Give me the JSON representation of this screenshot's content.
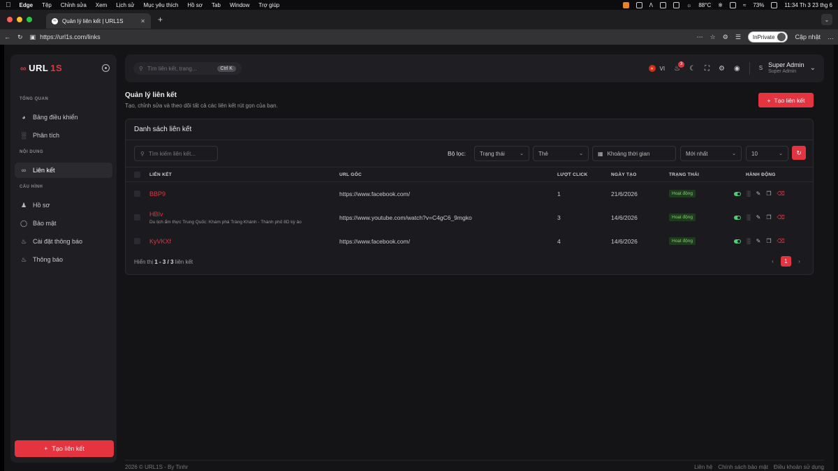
{
  "macbar": {
    "apple": "",
    "menus": [
      "Edge",
      "Tệp",
      "Chỉnh sửa",
      "Xem",
      "Lịch sử",
      "Mục yêu thích",
      "Hồ sơ",
      "Tab",
      "Window",
      "Trợ giúp"
    ],
    "weather": "88°C",
    "battery": "73%",
    "clock": "11:34 Th 3 23 thg 6"
  },
  "browser": {
    "tab_title": "Quản lý liên kết | URL1S",
    "url": "https://url1s.com/links",
    "inprivate": "InPrivate",
    "update": "Cập nhật"
  },
  "sidebar": {
    "logo_main": "URL",
    "logo_accent": "1S",
    "sections": [
      "TỔNG QUAN",
      "NỘI DUNG",
      "CẤU HÌNH"
    ],
    "items": [
      {
        "label": "Bảng điều khiển",
        "icon": "dashboard-icon"
      },
      {
        "label": "Phân tích",
        "icon": "chart-icon"
      },
      {
        "label": "Liên kết",
        "icon": "link-icon"
      },
      {
        "label": "Hồ sơ",
        "icon": "user-icon"
      },
      {
        "label": "Bảo mật",
        "icon": "shield-icon"
      },
      {
        "label": "Cài đặt thông báo",
        "icon": "bell-settings-icon"
      },
      {
        "label": "Thông báo",
        "icon": "bell-icon"
      }
    ],
    "cta": "Tạo liên kết"
  },
  "topbar": {
    "search_placeholder": "Tìm liên kết, trang...",
    "shortcut": "Ctrl K",
    "lang": "VI",
    "notif_count": "3",
    "user_initial": "S",
    "user_name": "Super Admin",
    "user_role": "Super Admin"
  },
  "main": {
    "title": "Quản lý liên kết",
    "subtitle": "Tạo, chỉnh sửa và theo dõi tất cả các liên kết rút gọn của bạn.",
    "add_button": "Tạo liên kết",
    "card_title": "Danh sách liên kết",
    "filter_search_placeholder": "Tìm kiếm liên kết...",
    "filter_label": "Bộ lọc:",
    "filter_status": "Trạng thái",
    "filter_tag": "Thẻ",
    "filter_date": "Khoảng thời gian",
    "filter_sort": "Mới nhất",
    "filter_page_size": "10",
    "columns": [
      "LIÊN KẾT",
      "URL GỐC",
      "LƯỢT CLICK",
      "NGÀY TẠO",
      "TRẠNG THÁI",
      "HÀNH ĐỘNG"
    ],
    "rows": [
      {
        "short": "BBP9",
        "title": "",
        "url": "https://www.facebook.com/",
        "clicks": "1",
        "date": "21/6/2026",
        "status": "Hoạt động"
      },
      {
        "short": "HBIv",
        "title": "Du lịch ẩm thực Trung Quốc: Khám phá Tràng Khánh - Thành phố 8D kỳ ảo",
        "url": "https://www.youtube.com/watch?v=C4gC6_9mgko",
        "clicks": "3",
        "date": "14/6/2026",
        "status": "Hoạt động"
      },
      {
        "short": "KyVKXf",
        "title": "",
        "url": "https://www.facebook.com/",
        "clicks": "4",
        "date": "14/6/2026",
        "status": "Hoạt động"
      }
    ],
    "footer_prefix": "Hiển thị",
    "footer_range": "1 - 3",
    "footer_sep": "/",
    "footer_total": "3",
    "footer_suffix": "liên kết",
    "current_page": "1"
  },
  "footer": {
    "copyright": "2026 © URL1S - By Tinhr",
    "links": [
      "Liên hệ",
      "Chính sách bảo mật",
      "Điều khoản sử dụng"
    ]
  }
}
